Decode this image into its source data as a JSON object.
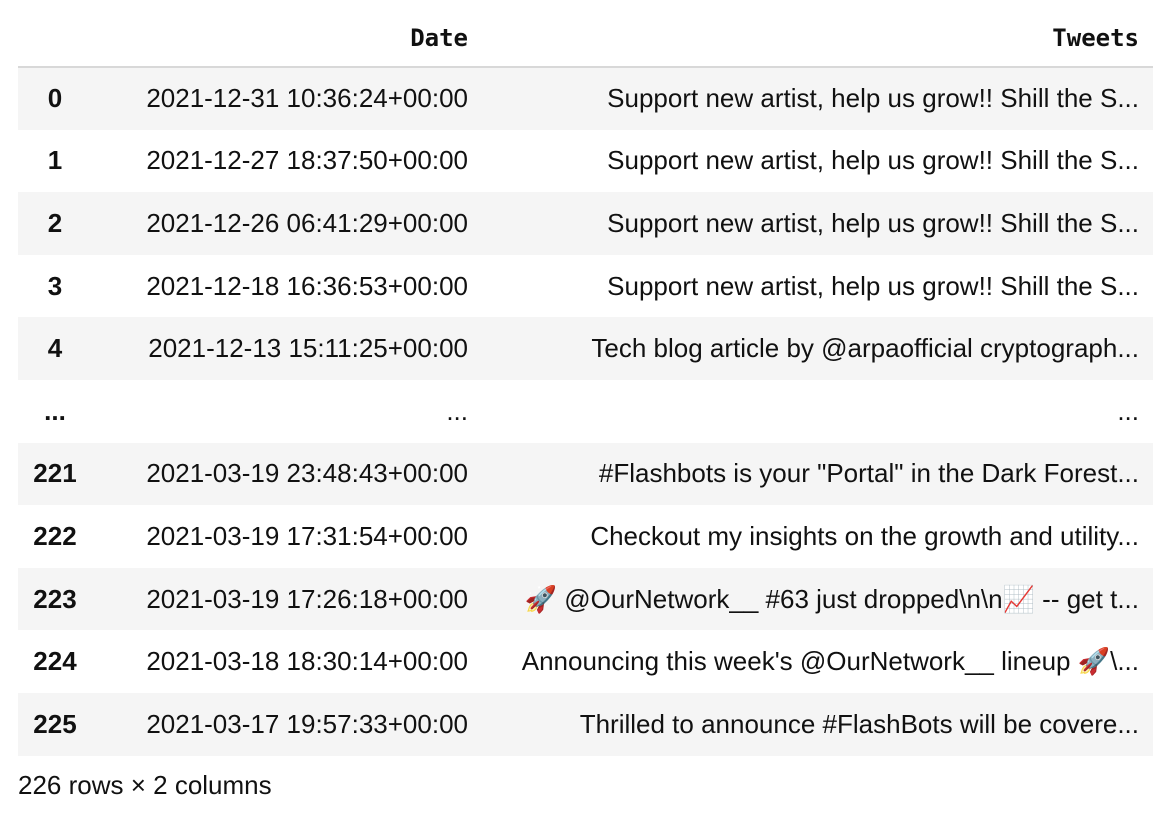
{
  "table": {
    "columns": [
      "Date",
      "Tweets"
    ],
    "rows": [
      {
        "index": "0",
        "date": "2021-12-31 10:36:24+00:00",
        "tweet": "Support new artist, help us grow!! Shill the S..."
      },
      {
        "index": "1",
        "date": "2021-12-27 18:37:50+00:00",
        "tweet": "Support new artist, help us grow!! Shill the S..."
      },
      {
        "index": "2",
        "date": "2021-12-26 06:41:29+00:00",
        "tweet": "Support new artist, help us grow!! Shill the S..."
      },
      {
        "index": "3",
        "date": "2021-12-18 16:36:53+00:00",
        "tweet": "Support new artist, help us grow!! Shill the S..."
      },
      {
        "index": "4",
        "date": "2021-12-13 15:11:25+00:00",
        "tweet": "Tech blog article by @arpaofficial cryptograph..."
      },
      {
        "index": "...",
        "date": "...",
        "tweet": "..."
      },
      {
        "index": "221",
        "date": "2021-03-19 23:48:43+00:00",
        "tweet": "#Flashbots is your \"Portal\" in the Dark Forest..."
      },
      {
        "index": "222",
        "date": "2021-03-19 17:31:54+00:00",
        "tweet": "Checkout my insights on the growth and utility..."
      },
      {
        "index": "223",
        "date": "2021-03-19 17:26:18+00:00",
        "tweet": "🚀 @OurNetwork__ #63 just dropped\\n\\n📈 -- get t..."
      },
      {
        "index": "224",
        "date": "2021-03-18 18:30:14+00:00",
        "tweet": "Announcing this week's @OurNetwork__ lineup 🚀\\..."
      },
      {
        "index": "225",
        "date": "2021-03-17 19:57:33+00:00",
        "tweet": "Thrilled to announce #FlashBots will be covere..."
      }
    ]
  },
  "footer": "226 rows × 2 columns"
}
